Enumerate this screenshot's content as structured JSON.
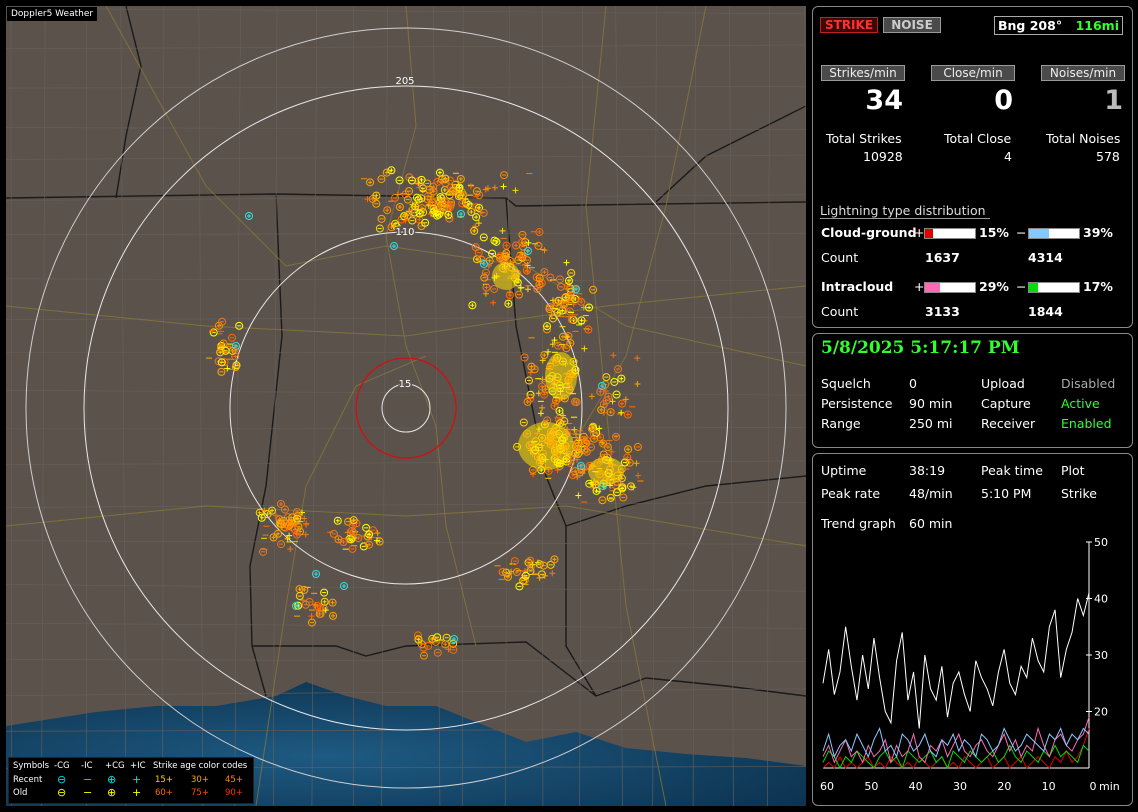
{
  "map": {
    "title": "Doppler5 Weather",
    "ring_labels": [
      "205",
      "110",
      "15"
    ],
    "legend": {
      "symbols_label": "Symbols",
      "headers": [
        "-CG",
        "-IC",
        "+CG",
        "+IC"
      ],
      "age_label": "Strike age color codes",
      "recent_label": "Recent",
      "old_label": "Old",
      "recent_ages": [
        "15+",
        "30+",
        "45+"
      ],
      "old_ages": [
        "60+",
        "75+",
        "90+"
      ],
      "age_colors": [
        "#ffd700",
        "#ffa500",
        "#ff8c00",
        "#ff6a00",
        "#ff5000",
        "#ff3000"
      ]
    }
  },
  "status": {
    "strike_label": "STRIKE",
    "noise_label": "NOISE",
    "bearing": "Bng 208°",
    "distance": "116mi",
    "strikes_min_label": "Strikes/min",
    "close_min_label": "Close/min",
    "noises_min_label": "Noises/min",
    "strikes_min": "34",
    "close_min": "0",
    "noises_min": "1",
    "total_strikes_label": "Total Strikes",
    "total_close_label": "Total Close",
    "total_noises_label": "Total Noises",
    "total_strikes": "10928",
    "total_close": "4",
    "total_noises": "578",
    "dist_title": "Lightning type distribution",
    "cg_label": "Cloud-ground",
    "ic_label": "Intracloud",
    "count_label": "Count",
    "plus": "+",
    "minus": "−",
    "cg_pos_pct": "15%",
    "cg_neg_pct": "39%",
    "ic_pos_pct": "29%",
    "ic_neg_pct": "17%",
    "cg_pos_frac": 0.15,
    "cg_neg_frac": 0.39,
    "ic_pos_frac": 0.29,
    "ic_neg_frac": 0.17,
    "cg_pos_count": "1637",
    "cg_neg_count": "4314",
    "ic_pos_count": "3133",
    "ic_neg_count": "1844",
    "colors": {
      "cg_pos": "#e00000",
      "cg_neg": "#87c8ff",
      "ic_pos": "#ff69b4",
      "ic_neg": "#00e000"
    }
  },
  "settings": {
    "datetime": "5/8/2025 5:17:17 PM",
    "squelch_label": "Squelch",
    "squelch": "0",
    "persistence_label": "Persistence",
    "persistence": "90 min",
    "range_label": "Range",
    "range": "250 mi",
    "upload_label": "Upload",
    "upload": "Disabled",
    "capture_label": "Capture",
    "capture": "Active",
    "receiver_label": "Receiver",
    "receiver": "Enabled"
  },
  "stats": {
    "uptime_label": "Uptime",
    "uptime": "38:19",
    "peak_time_label": "Peak time",
    "peak_time": "5:10 PM",
    "plot_label": "Plot",
    "plot": "Strike",
    "peak_rate_label": "Peak rate",
    "peak_rate": "48/min",
    "trend_label": "Trend graph",
    "trend": "60 min"
  },
  "chart_data": {
    "type": "line",
    "x_ticks": [
      "60",
      "50",
      "40",
      "30",
      "20",
      "10",
      "0"
    ],
    "x_unit": "min",
    "y_ticks": [
      "50",
      "40",
      "30",
      "20"
    ],
    "ylim": [
      10,
      50
    ],
    "xlim": [
      60,
      0
    ],
    "series": [
      {
        "color": "#ffffff",
        "values": [
          25,
          31,
          23,
          27,
          35,
          28,
          22,
          30,
          24,
          33,
          26,
          20,
          18,
          29,
          34,
          22,
          27,
          17,
          30,
          24,
          22,
          28,
          19,
          25,
          27,
          23,
          20,
          29,
          26,
          24,
          21,
          27,
          31,
          25,
          23,
          28,
          26,
          33,
          29,
          27,
          35,
          38,
          26,
          31,
          34,
          40,
          37,
          41
        ]
      },
      {
        "color": "#87c8ff",
        "values": [
          13,
          16,
          12,
          14,
          15,
          13,
          16,
          14,
          12,
          15,
          17,
          13,
          14,
          12,
          16,
          15,
          13,
          14,
          16,
          13,
          12,
          15,
          14,
          16,
          13,
          15,
          14,
          12,
          16,
          15,
          13,
          14,
          17,
          15,
          13,
          14,
          16,
          15,
          14,
          13,
          16,
          15,
          17,
          14,
          16,
          15,
          17,
          16
        ]
      },
      {
        "color": "#ff69b4",
        "values": [
          12,
          14,
          11,
          13,
          15,
          12,
          13,
          11,
          14,
          12,
          13,
          15,
          11,
          14,
          12,
          13,
          16,
          12,
          11,
          14,
          13,
          15,
          12,
          14,
          16,
          13,
          12,
          14,
          15,
          13,
          12,
          14,
          16,
          13,
          15,
          12,
          14,
          13,
          17,
          14,
          12,
          15,
          16,
          14,
          13,
          15,
          16,
          19
        ]
      },
      {
        "color": "#00e000",
        "values": [
          11,
          13,
          12,
          10,
          12,
          11,
          13,
          12,
          11,
          10,
          12,
          13,
          11,
          12,
          10,
          13,
          12,
          11,
          12,
          13,
          11,
          12,
          10,
          13,
          12,
          11,
          13,
          12,
          11,
          12,
          13,
          11,
          12,
          14,
          12,
          11,
          13,
          12,
          11,
          13,
          12,
          14,
          12,
          13,
          12,
          11,
          14,
          13
        ]
      },
      {
        "color": "#e00000",
        "values": [
          10,
          11,
          10,
          12,
          10,
          11,
          10,
          11,
          12,
          10,
          11,
          10,
          12,
          11,
          10,
          11,
          10,
          12,
          11,
          10,
          11,
          12,
          10,
          11,
          10,
          12,
          11,
          10,
          11,
          12,
          10,
          11,
          12,
          10,
          11,
          12,
          10,
          11,
          12,
          11,
          10,
          12,
          11,
          13,
          11,
          12,
          14,
          17
        ]
      }
    ]
  }
}
